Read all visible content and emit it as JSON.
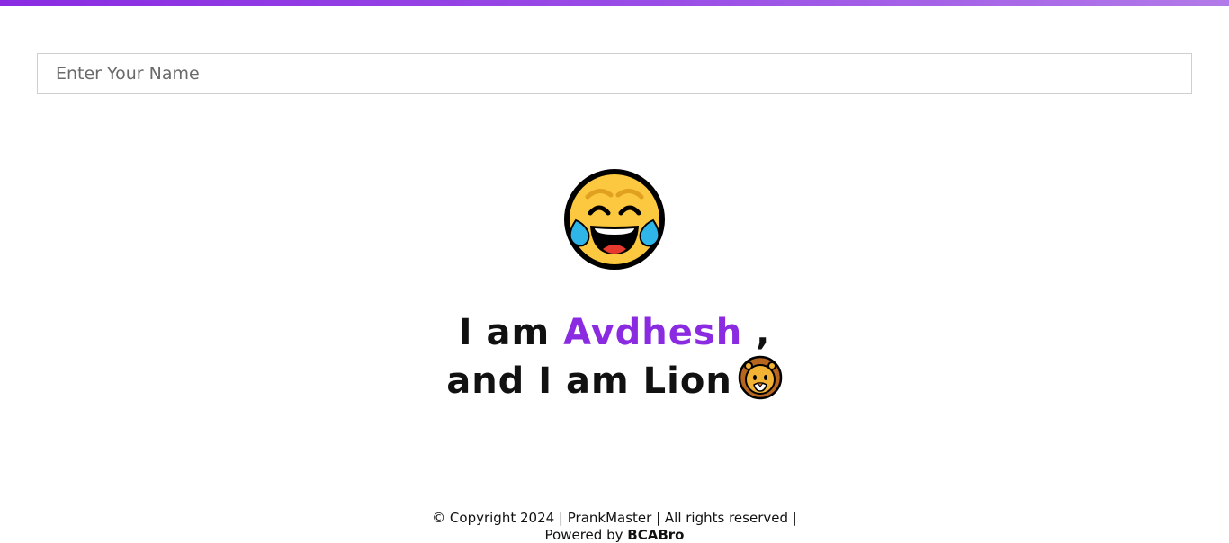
{
  "input": {
    "placeholder": "Enter Your Name",
    "value": ""
  },
  "message": {
    "prefix": "I am",
    "name": "Avdhesh",
    "suffix": ",",
    "line2": "and I am Lion"
  },
  "icons": {
    "hero": "face-with-tears-of-joy-icon",
    "lion": "lion-face-icon"
  },
  "footer": {
    "copyright": "© Copyright 2024 | PrankMaster | All rights reserved |",
    "powered_label": "Powered by",
    "powered_brand": "BCABro"
  },
  "colors": {
    "accent": "#8a2be2",
    "text": "#111111"
  }
}
